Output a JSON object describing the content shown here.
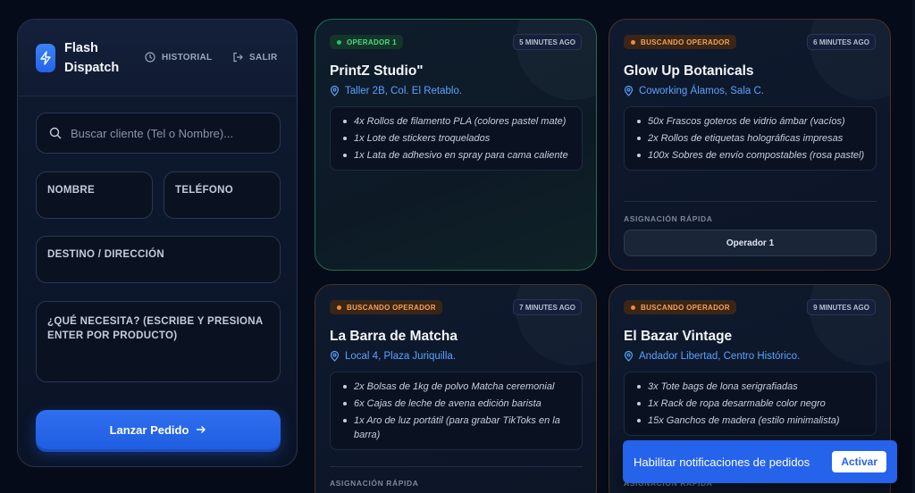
{
  "app": {
    "brand_line1": "Flash",
    "brand_line2": "Dispatch",
    "nav_history": "HISTORIAL",
    "nav_exit": "SALIR"
  },
  "form": {
    "search_placeholder": "Buscar cliente (Tel o Nombre)...",
    "name_label": "NOMBRE",
    "phone_label": "TELÉFONO",
    "destination_label": "DESTINO / DIRECCIÓN",
    "need_label": "¿QUÉ NECESITA? (ESCRIBE Y PRESIONA ENTER POR PRODUCTO)",
    "launch_button": "Lanzar Pedido"
  },
  "orders": [
    {
      "status": "OPERADOR 1",
      "status_color": "#22c55e",
      "time": "5 MINUTES AGO",
      "client": "PrintZ Studio\"",
      "location": "Taller 2B, Col. El Retablo.",
      "items": [
        "4x Rollos de filamento PLA (colores pastel mate)",
        "1x Lote de stickers troquelados",
        "1x Lata de adhesivo en spray para cama caliente"
      ]
    },
    {
      "status": "BUSCANDO OPERADOR",
      "status_color": "#f08a3c",
      "time": "6 MINUTES AGO",
      "client": "Glow Up Botanicals",
      "location": "Coworking Álamos, Sala C.",
      "items": [
        "50x Frascos goteros de vidrio ámbar (vacíos)",
        "2x Rollos de etiquetas holográficas impresas",
        "100x Sobres de envío compostables (rosa pastel)"
      ],
      "quick_assign_label": "ASIGNACIÓN RÁPIDA",
      "quick_assign_option": "Operador 1"
    },
    {
      "status": "BUSCANDO OPERADOR",
      "status_color": "#f08a3c",
      "time": "7 MINUTES AGO",
      "client": "La Barra de Matcha",
      "location": "Local 4, Plaza Juriquilla.",
      "items": [
        "2x Bolsas de 1kg de polvo Matcha ceremonial",
        "6x Cajas de leche de avena edición barista",
        "1x Aro de luz portátil (para grabar TikToks en la barra)"
      ],
      "quick_assign_label": "ASIGNACIÓN RÁPIDA"
    },
    {
      "status": "BUSCANDO OPERADOR",
      "status_color": "#f08a3c",
      "time": "9 MINUTES AGO",
      "client": "El Bazar Vintage",
      "location": "Andador Libertad, Centro Histórico.",
      "items": [
        "3x Tote bags de lona serigrafiadas",
        "1x Rack de ropa desarmable color negro",
        "15x Ganchos de madera (estilo minimalista)"
      ],
      "quick_assign_label": "ASIGNACIÓN RÁPIDA"
    }
  ],
  "toast": {
    "message": "Habilitar notificaciones de pedidos",
    "action": "Activar"
  },
  "colors": {
    "accent": "#2563eb",
    "link": "#5aa2ff",
    "background": "#050b18"
  }
}
